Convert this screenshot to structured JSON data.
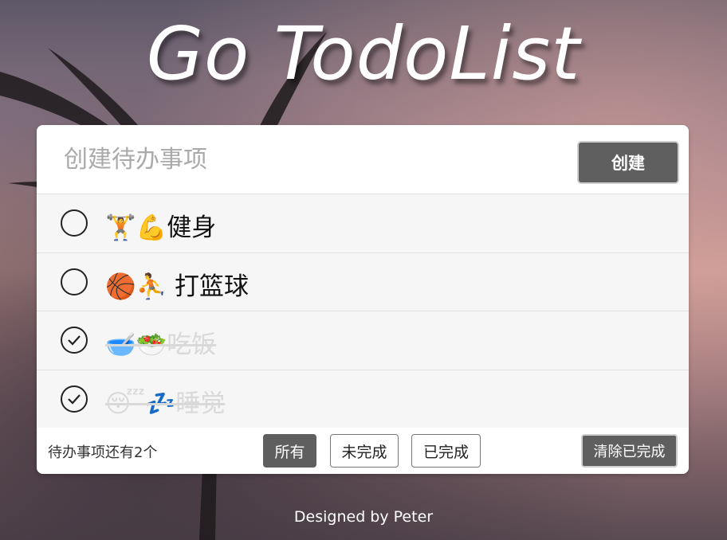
{
  "header": {
    "title": "Go TodoList"
  },
  "new_todo": {
    "placeholder": "创建待办事项",
    "create_label": "创建"
  },
  "todos": [
    {
      "text": "🏋️💪健身",
      "completed": false
    },
    {
      "text": "🏀⛹️ 打篮球",
      "completed": false
    },
    {
      "text": "🥣🥗吃饭",
      "completed": true
    },
    {
      "text": "😴💤睡觉",
      "completed": true
    }
  ],
  "footer": {
    "remaining_text": "待办事项还有2个",
    "filters": [
      "所有",
      "未完成",
      "已完成"
    ],
    "active_filter": "所有",
    "clear_label": "清除已完成"
  },
  "credit": "Designed by Peter",
  "colors": {
    "button_bg": "#5f5f5f",
    "card_bg": "#f6f6f6"
  }
}
